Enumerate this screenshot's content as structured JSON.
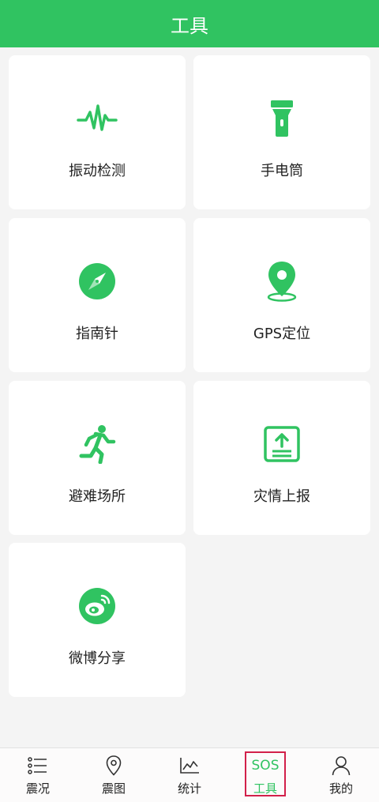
{
  "header": {
    "title": "工具"
  },
  "tools": [
    {
      "label": "振动检测",
      "icon": "pulse-icon"
    },
    {
      "label": "手电筒",
      "icon": "flashlight-icon"
    },
    {
      "label": "指南针",
      "icon": "compass-icon"
    },
    {
      "label": "GPS定位",
      "icon": "location-pin-icon"
    },
    {
      "label": "避难场所",
      "icon": "running-person-icon"
    },
    {
      "label": "灾情上报",
      "icon": "upload-report-icon"
    },
    {
      "label": "微博分享",
      "icon": "weibo-icon"
    }
  ],
  "tabbar": {
    "tabs": [
      {
        "label": "震况",
        "icon": "list-icon"
      },
      {
        "label": "震图",
        "icon": "map-pin-icon"
      },
      {
        "label": "统计",
        "icon": "line-chart-icon"
      },
      {
        "label": "工具",
        "icon": "sos-icon",
        "icon_text": "SOS",
        "active": true
      },
      {
        "label": "我的",
        "icon": "user-icon"
      }
    ]
  },
  "colors": {
    "accent": "#30c361",
    "highlight_box": "#d2204a"
  }
}
